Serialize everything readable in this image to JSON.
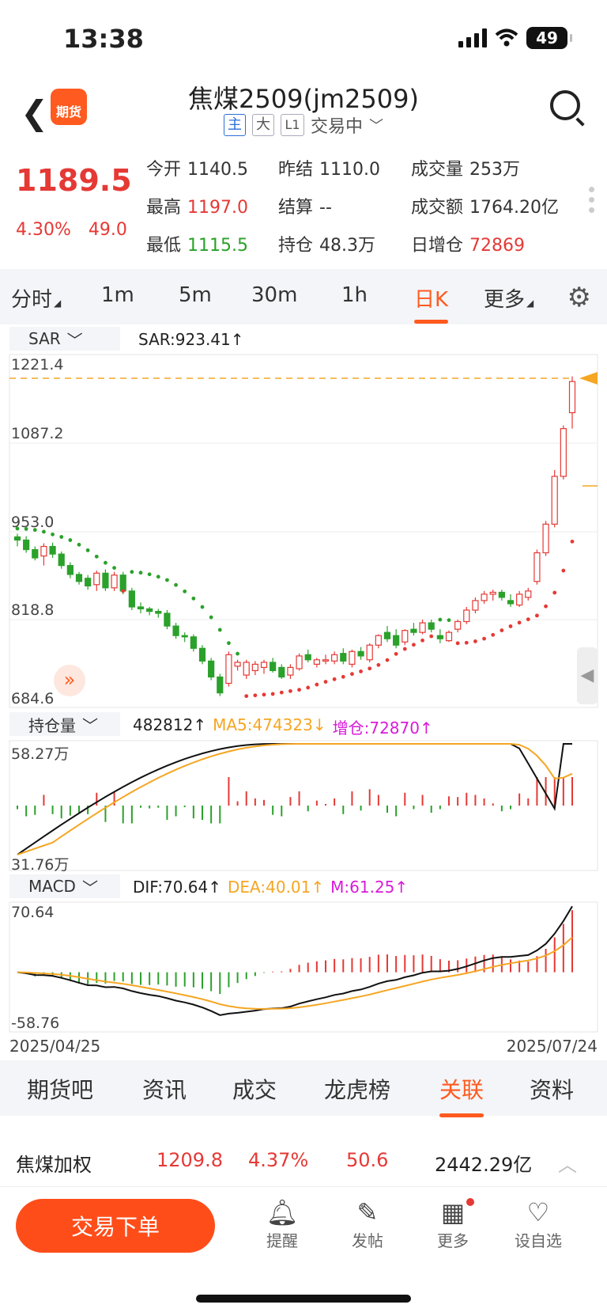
{
  "status": {
    "time": "13:38",
    "battery": "49"
  },
  "header": {
    "logo_text": "期货",
    "title": "焦煤2509(jm2509)",
    "tag_main": "主",
    "tag_big": "大",
    "tag_l1": "L1",
    "trade_status": "交易中"
  },
  "quote": {
    "price": "1189.5",
    "pct": "4.30%",
    "change": "49.0",
    "cells": [
      {
        "label": "今开",
        "value": "1140.5",
        "color": "#333333"
      },
      {
        "label": "昨结",
        "value": "1110.0",
        "color": "#333333"
      },
      {
        "label": "成交量",
        "value": "253万",
        "color": "#333333"
      },
      {
        "label": "最高",
        "value": "1197.0",
        "color": "#e53935"
      },
      {
        "label": "结算",
        "value": "--",
        "color": "#333333"
      },
      {
        "label": "成交额",
        "value": "1764.20亿",
        "color": "#333333"
      },
      {
        "label": "最低",
        "value": "1115.5",
        "color": "#2aa12a"
      },
      {
        "label": "持仓",
        "value": "48.3万",
        "color": "#333333"
      },
      {
        "label": "日增仓",
        "value": "72869",
        "color": "#e53935"
      }
    ]
  },
  "period_tabs": [
    "分时",
    "1m",
    "5m",
    "30m",
    "1h",
    "日K",
    "更多"
  ],
  "sar": {
    "selector": "SAR",
    "value": "SAR:923.41↑"
  },
  "main_axis": [
    "1221.4",
    "1087.2",
    "953.0",
    "818.8",
    "684.6"
  ],
  "oi": {
    "selector": "持仓量",
    "value": "482812↑",
    "ma5": "MA5:474323↓",
    "add": "增仓:72870↑",
    "axis_top": "58.27万",
    "axis_bottom": "31.76万"
  },
  "macd": {
    "selector": "MACD",
    "dif": "DIF:70.64↑",
    "dea": "DEA:40.01↑",
    "m": "M:61.25↑",
    "axis_top": "70.64",
    "axis_bottom": "-58.76"
  },
  "dates": {
    "start": "2025/04/25",
    "end": "2025/07/24"
  },
  "bottom_tabs": [
    "期货吧",
    "资讯",
    "成交",
    "龙虎榜",
    "关联",
    "资料"
  ],
  "related": {
    "name": "焦煤加权",
    "price": "1209.8",
    "pct": "4.37%",
    "change": "50.6",
    "amount": "2442.29亿"
  },
  "actions": {
    "order": "交易下单",
    "remind": "提醒",
    "post": "发帖",
    "more": "更多",
    "watch": "设自选"
  },
  "colors": {
    "up": "#e53935",
    "down": "#2aa12a",
    "accent": "#ff5a1f",
    "ma": "#f5a623"
  },
  "chart_data": {
    "type": "candlestick",
    "ylim": [
      684.6,
      1221.4
    ],
    "dates": [
      "2025/04/25",
      "2025/07/24"
    ],
    "ohlc": [
      [
        945,
        950,
        930,
        940
      ],
      [
        940,
        946,
        920,
        925
      ],
      [
        925,
        930,
        908,
        912
      ],
      [
        915,
        935,
        900,
        930
      ],
      [
        930,
        936,
        912,
        918
      ],
      [
        918,
        922,
        895,
        900
      ],
      [
        900,
        905,
        880,
        886
      ],
      [
        886,
        890,
        870,
        875
      ],
      [
        880,
        885,
        862,
        868
      ],
      [
        870,
        892,
        860,
        888
      ],
      [
        888,
        894,
        860,
        865
      ],
      [
        865,
        890,
        860,
        885
      ],
      [
        885,
        890,
        855,
        860
      ],
      [
        860,
        865,
        830,
        835
      ],
      [
        835,
        842,
        825,
        832
      ],
      [
        832,
        835,
        822,
        828
      ],
      [
        828,
        832,
        818,
        825
      ],
      [
        825,
        830,
        800,
        805
      ],
      [
        805,
        810,
        785,
        790
      ],
      [
        790,
        795,
        780,
        788
      ],
      [
        788,
        792,
        765,
        770
      ],
      [
        770,
        775,
        745,
        750
      ],
      [
        750,
        755,
        720,
        725
      ],
      [
        725,
        730,
        695,
        700
      ],
      [
        715,
        765,
        710,
        760
      ],
      [
        742,
        752,
        735,
        748
      ],
      [
        728,
        752,
        722,
        748
      ],
      [
        735,
        750,
        728,
        745
      ],
      [
        740,
        752,
        730,
        748
      ],
      [
        748,
        755,
        732,
        735
      ],
      [
        740,
        745,
        722,
        725
      ],
      [
        728,
        745,
        722,
        740
      ],
      [
        738,
        762,
        735,
        758
      ],
      [
        760,
        768,
        748,
        752
      ],
      [
        745,
        755,
        740,
        752
      ],
      [
        750,
        760,
        745,
        752
      ],
      [
        750,
        765,
        745,
        760
      ],
      [
        762,
        770,
        745,
        750
      ],
      [
        745,
        768,
        740,
        765
      ],
      [
        765,
        772,
        752,
        758
      ],
      [
        752,
        778,
        748,
        775
      ],
      [
        775,
        792,
        770,
        790
      ],
      [
        795,
        805,
        780,
        785
      ],
      [
        790,
        800,
        770,
        775
      ],
      [
        780,
        800,
        775,
        798
      ],
      [
        800,
        810,
        790,
        795
      ],
      [
        795,
        815,
        792,
        810
      ],
      [
        810,
        815,
        795,
        800
      ],
      [
        790,
        800,
        778,
        785
      ],
      [
        782,
        798,
        780,
        795
      ],
      [
        800,
        815,
        795,
        812
      ],
      [
        812,
        835,
        808,
        830
      ],
      [
        830,
        850,
        825,
        845
      ],
      [
        845,
        860,
        840,
        855
      ],
      [
        855,
        862,
        845,
        858
      ],
      [
        858,
        862,
        845,
        850
      ],
      [
        845,
        855,
        835,
        840
      ],
      [
        838,
        860,
        835,
        855
      ],
      [
        850,
        865,
        845,
        860
      ],
      [
        875,
        925,
        870,
        920
      ],
      [
        920,
        970,
        915,
        965
      ],
      [
        965,
        1050,
        960,
        1040
      ],
      [
        1040,
        1120,
        1035,
        1115
      ],
      [
        1140,
        1197,
        1115,
        1189
      ]
    ]
  }
}
